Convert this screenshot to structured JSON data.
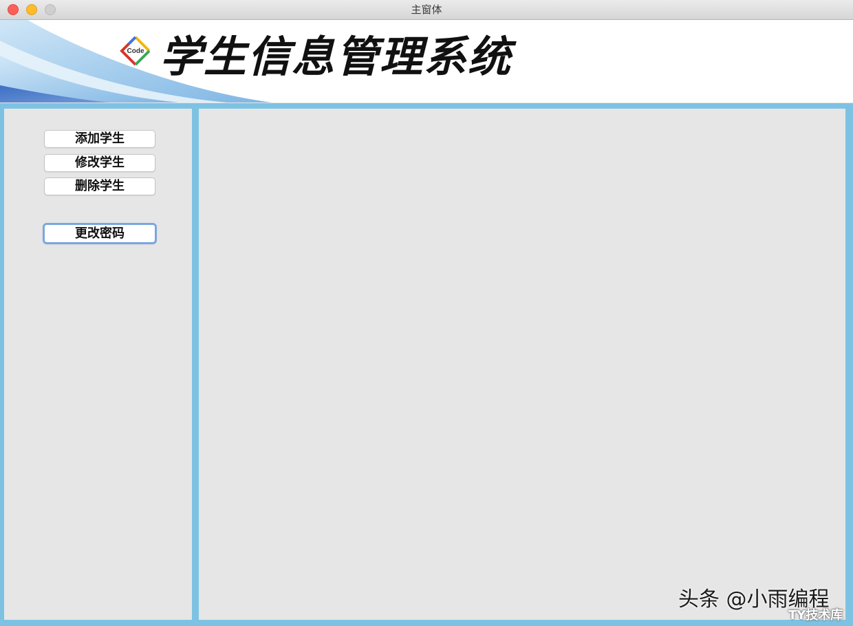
{
  "window": {
    "title": "主窗体"
  },
  "banner": {
    "title": "学生信息管理系统",
    "logo_text": "Code"
  },
  "sidebar": {
    "buttons": [
      {
        "label": "添加学生"
      },
      {
        "label": "修改学生"
      },
      {
        "label": "删除学生"
      },
      {
        "label": "更改密码",
        "focused": true
      }
    ]
  },
  "watermark": {
    "main": "头条 @小雨编程",
    "sub": "TY技术库"
  },
  "colors": {
    "frame_blue": "#7ec2e3",
    "panel_gray": "#e6e6e6",
    "focus_ring": "#7aa7e0"
  }
}
